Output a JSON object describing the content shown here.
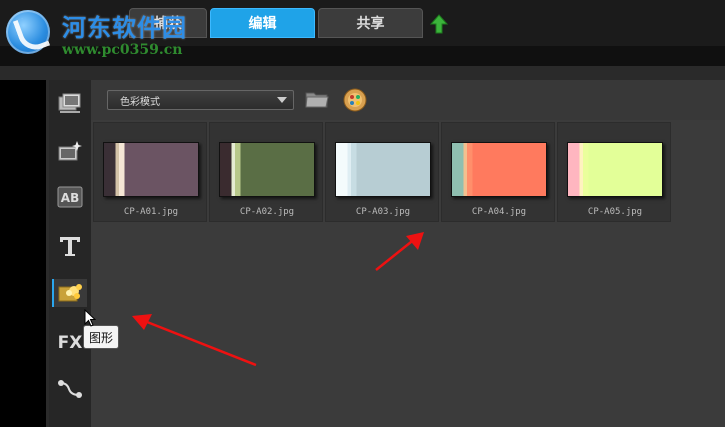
{
  "watermark": {
    "title": "河东软件园",
    "url": "www.pc0359.cn"
  },
  "tabs": [
    {
      "label": "捕获",
      "active": false
    },
    {
      "label": "编辑",
      "active": true
    },
    {
      "label": "共享",
      "active": false
    }
  ],
  "accent_color": "#1fa3e8",
  "filter": {
    "selected": "色彩模式"
  },
  "toolbar": {
    "items": [
      "media-icon",
      "instant-project-icon",
      "transition-ab-icon",
      "title-t-icon",
      "graphics-icon",
      "fx-icon",
      "motion-path-icon"
    ],
    "tooltip": "图形"
  },
  "library": {
    "items": [
      {
        "name": "CP-A01.jpg",
        "colors": [
          "#3a2f36",
          "#d4c2a8",
          "#f5e6d5",
          "#6b5463"
        ]
      },
      {
        "name": "CP-A02.jpg",
        "colors": [
          "#3a2b2f",
          "#e6ecd2",
          "#b8c88a",
          "#5a6e45"
        ]
      },
      {
        "name": "CP-A03.jpg",
        "colors": [
          "#f4fbfc",
          "#dfeef3",
          "#c7dde3",
          "#b7cdd3"
        ]
      },
      {
        "name": "CP-A04.jpg",
        "colors": [
          "#8fbfb0",
          "#f2c08f",
          "#ff8f6b",
          "#ff7a5e"
        ]
      },
      {
        "name": "CP-A05.jpg",
        "colors": [
          "#ffb6c0",
          "#fff2c0",
          "#eaff9c",
          "#e3ff98"
        ]
      }
    ]
  }
}
